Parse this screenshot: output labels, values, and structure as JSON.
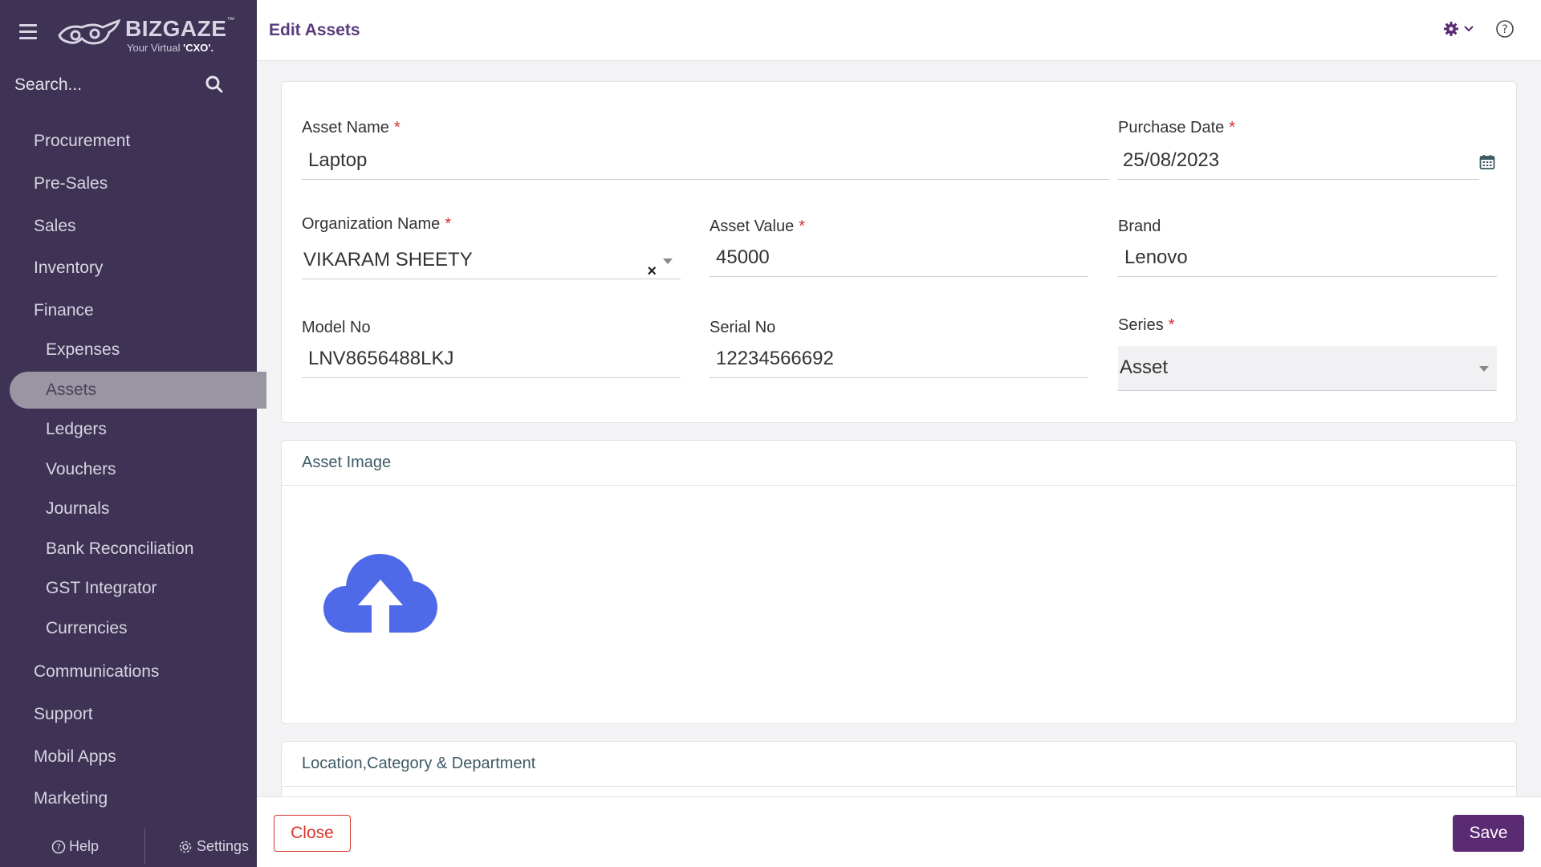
{
  "app": {
    "brand": "BIZGAZE",
    "brand_tm": "™",
    "tagline_prefix": "Your Virtual ",
    "tagline_bold": "'CXO'."
  },
  "search": {
    "placeholder": "Search..."
  },
  "sidebar": {
    "items": [
      {
        "label": "Procurement"
      },
      {
        "label": "Pre-Sales"
      },
      {
        "label": "Sales"
      },
      {
        "label": "Inventory"
      },
      {
        "label": "Finance"
      },
      {
        "label": "Expenses"
      },
      {
        "label": "Assets"
      },
      {
        "label": "Ledgers"
      },
      {
        "label": "Vouchers"
      },
      {
        "label": "Journals"
      },
      {
        "label": "Bank Reconciliation"
      },
      {
        "label": "GST Integrator"
      },
      {
        "label": "Currencies"
      },
      {
        "label": "Communications"
      },
      {
        "label": "Support"
      },
      {
        "label": "Mobil Apps"
      },
      {
        "label": "Marketing"
      }
    ],
    "active": "Assets",
    "footer": {
      "help": "Help",
      "settings": "Settings"
    }
  },
  "header": {
    "title": "Edit Assets"
  },
  "form": {
    "asset_name": {
      "label": "Asset Name",
      "value": "Laptop",
      "required": "*"
    },
    "purchase_date": {
      "label": "Purchase Date",
      "value": "25/08/2023",
      "required": "*"
    },
    "organization_name": {
      "label": "Organization Name",
      "value": "VIKARAM SHEETY",
      "required": "*",
      "clear": "×"
    },
    "asset_value": {
      "label": "Asset Value",
      "value": "45000",
      "required": "*"
    },
    "brand": {
      "label": "Brand",
      "value": "Lenovo"
    },
    "model_no": {
      "label": "Model No",
      "value": "LNV8656488LKJ"
    },
    "serial_no": {
      "label": "Serial No",
      "value": "12234566692"
    },
    "series": {
      "label": "Series",
      "value": "Asset",
      "required": "*"
    }
  },
  "sections": {
    "asset_image": "Asset Image",
    "location": "Location,Category & Department"
  },
  "footer": {
    "close_label": "Close",
    "save_label": "Save"
  },
  "colors": {
    "sidebar_bg": "#3e3354",
    "accent": "#5a2a73",
    "upload_icon": "#4f6ae8",
    "required": "#d32f2f",
    "close_border": "#d9342b"
  },
  "icons": {
    "menu": "hamburger-icon",
    "search": "search-icon",
    "settings": "gear-icon",
    "help": "question-circle-icon",
    "calendar": "calendar-icon",
    "upload": "cloud-upload-icon"
  }
}
